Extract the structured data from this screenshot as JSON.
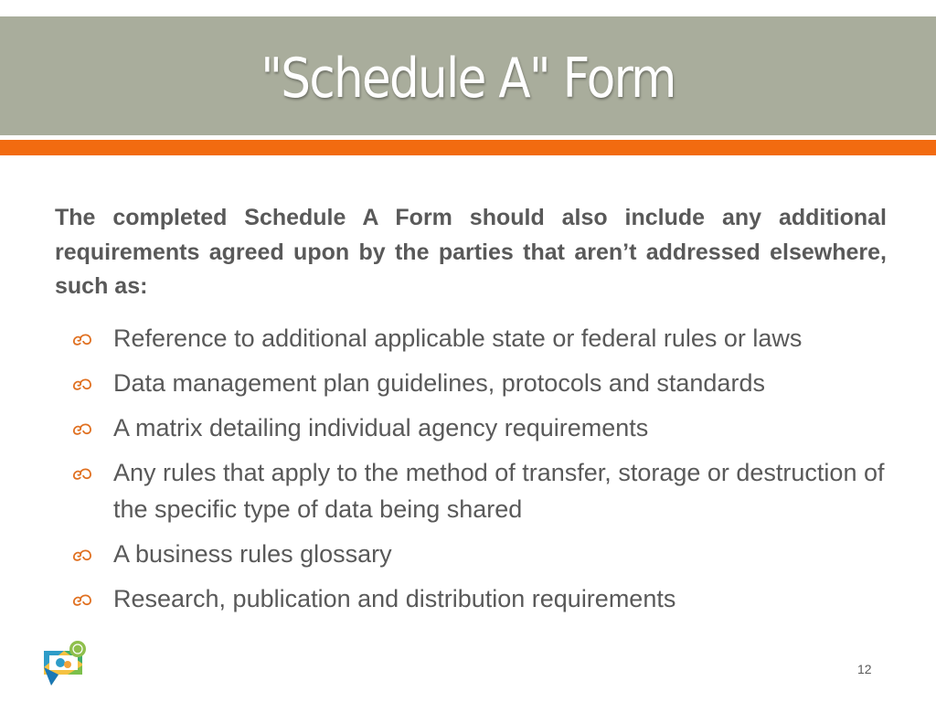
{
  "slide": {
    "title": "\"Schedule A\" Form",
    "intro": "The completed Schedule A Form should also include any additional requirements agreed upon by the parties that aren’t addressed elsewhere, such as:",
    "bullets": [
      "Reference to additional applicable state or federal rules or laws",
      "Data management plan guidelines, protocols and standards",
      "A matrix detailing individual agency requirements",
      "Any rules that apply to the method of transfer, storage or destruction of the specific type of data being shared",
      "A business rules glossary",
      "Research, publication and distribution requirements"
    ],
    "bullet_icon": "ornament-bullet-icon",
    "page_number": "12"
  },
  "colors": {
    "title_bar": "#a9ad9c",
    "accent": "#f26b10",
    "text": "#595959"
  }
}
